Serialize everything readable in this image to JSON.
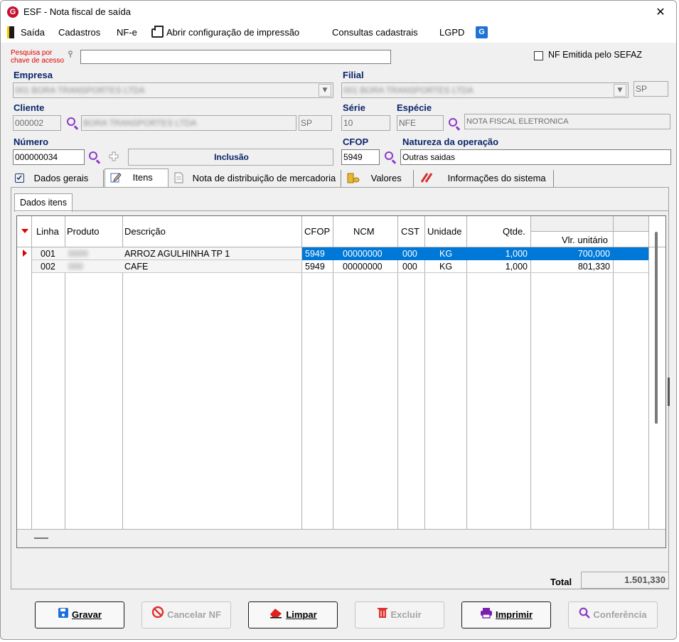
{
  "window": {
    "title": "ESF - Nota fiscal de saída",
    "close": "✕"
  },
  "menu": {
    "exit": "Saída",
    "registrations": "Cadastros",
    "nfe": "NF-e",
    "print_config": "Abrir configuração de impressão",
    "queries": "Consultas cadastrais",
    "lgpd": "LGPD"
  },
  "search": {
    "label_line1": "Pesquisa por",
    "label_line2": "chave de acesso",
    "value": ""
  },
  "sefaz": {
    "label": "NF Emitida pelo SEFAZ",
    "checked": false
  },
  "company": {
    "label": "Empresa",
    "value": "001 BORA TRANSPORTES LTDA"
  },
  "branch": {
    "label": "Filial",
    "value": "001 BORA TRANSPORTES LTDA",
    "state": "SP"
  },
  "client": {
    "label": "Cliente",
    "code": "000002",
    "name": "BORA TRANSPORTES LTDA",
    "state": "SP"
  },
  "series": {
    "label": "Série",
    "value": "10"
  },
  "species": {
    "label": "Espécie",
    "code": "NFE",
    "description": "NOTA FISCAL ELETRONICA"
  },
  "number": {
    "label": "Número",
    "value": "000000034",
    "mode": "Inclusão"
  },
  "cfop": {
    "label": "CFOP",
    "value": "5949"
  },
  "operation": {
    "label": "Natureza da operação",
    "value": "Outras saidas"
  },
  "tabs": [
    {
      "label": "Dados gerais"
    },
    {
      "label": "Itens"
    },
    {
      "label": "Nota de distribuição de mercadoria"
    },
    {
      "label": "Valores"
    },
    {
      "label": "Informações do sistema"
    }
  ],
  "subtab": "Dados itens",
  "grid": {
    "columns": [
      "Linha",
      "Produto",
      "Descrição",
      "CFOP",
      "NCM",
      "CST",
      "Unidade",
      "Qtde.",
      "Vlr. unitário"
    ],
    "rows": [
      {
        "line": "001",
        "product": "0000",
        "description": "ARROZ AGULHINHA TP 1",
        "cfop": "5949",
        "ncm": "00000000",
        "cst": "000",
        "unit": "KG",
        "qty": "1,000",
        "price": "700,000"
      },
      {
        "line": "002",
        "product": "000",
        "description": "CAFE",
        "cfop": "5949",
        "ncm": "00000000",
        "cst": "000",
        "unit": "KG",
        "qty": "1,000",
        "price": "801,330"
      }
    ]
  },
  "total": {
    "label": "Total",
    "value": "1.501,330"
  },
  "buttons": {
    "save": "Gravar",
    "cancel": "Cancelar NF",
    "clear": "Limpar",
    "delete": "Excluir",
    "print": "Imprimir",
    "check": "Conferência"
  },
  "colors": {
    "label_blue": "#0a246a",
    "selection": "#0078d7",
    "accent_purple": "#8c38c8",
    "brand_red": "#c8102e"
  }
}
